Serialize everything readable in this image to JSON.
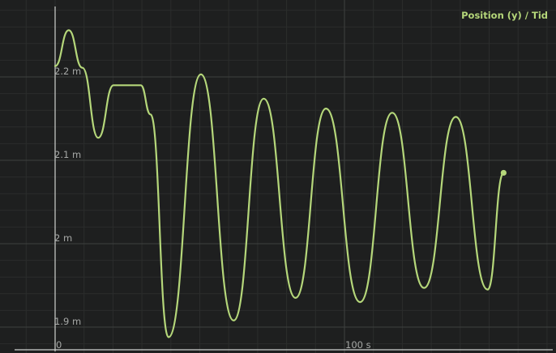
{
  "chart_data": {
    "type": "line",
    "title": "Position (y) / Tid",
    "xlabel": "",
    "ylabel": "",
    "xlim": [
      0,
      155
    ],
    "ylim": [
      1.88,
      2.285
    ],
    "x_ticks": [
      {
        "value": 0,
        "label": "0"
      },
      {
        "value": 100,
        "label": "100 s"
      }
    ],
    "y_ticks": [
      {
        "value": 1.9,
        "label": "1.9 m"
      },
      {
        "value": 2.0,
        "label": "2 m"
      },
      {
        "value": 2.1,
        "label": "2.1 m"
      },
      {
        "value": 2.2,
        "label": "2.2 m"
      }
    ],
    "grid": true,
    "series": [
      {
        "color": "#b5d77a",
        "end_marker": true,
        "points": [
          [
            0,
            2.213
          ],
          [
            4.7,
            2.256
          ],
          [
            9.4,
            2.211
          ],
          [
            14.9,
            2.127
          ],
          [
            20.2,
            2.19
          ],
          [
            29.6,
            2.19
          ],
          [
            33,
            2.155
          ],
          [
            39.2,
            1.888
          ],
          [
            50.4,
            2.203
          ],
          [
            61.7,
            1.908
          ],
          [
            72.1,
            2.174
          ],
          [
            83.1,
            1.935
          ],
          [
            93.6,
            2.162
          ],
          [
            105.4,
            1.93
          ],
          [
            116.5,
            2.157
          ],
          [
            127.5,
            1.947
          ],
          [
            138.5,
            2.152
          ],
          [
            149.5,
            1.945
          ],
          [
            155,
            2.085
          ]
        ]
      }
    ]
  }
}
